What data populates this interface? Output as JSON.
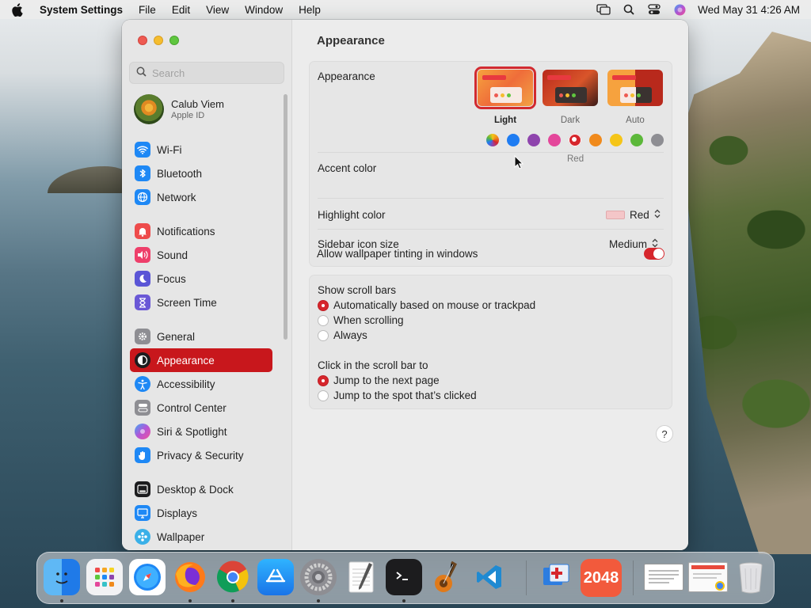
{
  "menubar": {
    "app_name": "System Settings",
    "menus": [
      "File",
      "Edit",
      "View",
      "Window",
      "Help"
    ],
    "clock": "Wed May 31  4:26 AM"
  },
  "sidebar": {
    "search_placeholder": "Search",
    "user": {
      "name": "Calub Viem",
      "subtitle": "Apple ID"
    },
    "items": [
      {
        "label": "Wi-Fi",
        "icon": "wifi-icon",
        "color": "#1e88f5"
      },
      {
        "label": "Bluetooth",
        "icon": "bluetooth-icon",
        "color": "#1e88f5"
      },
      {
        "label": "Network",
        "icon": "globe-icon",
        "color": "#1e88f5"
      },
      {
        "label": "Notifications",
        "icon": "bell-icon",
        "color": "#ee4b4b"
      },
      {
        "label": "Sound",
        "icon": "speaker-icon",
        "color": "#ee3f6a"
      },
      {
        "label": "Focus",
        "icon": "moon-icon",
        "color": "#5a55d6"
      },
      {
        "label": "Screen Time",
        "icon": "hourglass-icon",
        "color": "#6a58d6"
      },
      {
        "label": "General",
        "icon": "gear-icon",
        "color": "#8e8e93"
      },
      {
        "label": "Appearance",
        "icon": "appearance-icon",
        "color": "#1c1c1e"
      },
      {
        "label": "Accessibility",
        "icon": "accessibility-icon",
        "color": "#1e88f5"
      },
      {
        "label": "Control Center",
        "icon": "control-center-icon",
        "color": "#8e8e93"
      },
      {
        "label": "Siri & Spotlight",
        "icon": "siri-icon",
        "color": "#b455d6"
      },
      {
        "label": "Privacy & Security",
        "icon": "hand-icon",
        "color": "#1e88f5"
      },
      {
        "label": "Desktop & Dock",
        "icon": "dock-icon",
        "color": "#1c1c1e"
      },
      {
        "label": "Displays",
        "icon": "display-icon",
        "color": "#1e88f5"
      },
      {
        "label": "Wallpaper",
        "icon": "wallpaper-icon",
        "color": "#3ab0e8"
      }
    ],
    "selected": "Appearance"
  },
  "content": {
    "title": "Appearance",
    "appearance": {
      "label": "Appearance",
      "options": [
        "Light",
        "Dark",
        "Auto"
      ],
      "selected": "Light"
    },
    "accent": {
      "label": "Accent color",
      "colors": [
        "#multicolor",
        "#1e7cf2",
        "#8e44ad",
        "#e4479b",
        "#d6262c",
        "#f08a1c",
        "#f5c518",
        "#5cb83a",
        "#8e8e93"
      ],
      "selected_name": "Red"
    },
    "highlight": {
      "label": "Highlight color",
      "value": "Red"
    },
    "sidebar_icon_size": {
      "label": "Sidebar icon size",
      "value": "Medium"
    },
    "wallpaper_tinting": {
      "label": "Allow wallpaper tinting in windows",
      "on": true
    },
    "scroll_bars": {
      "title": "Show scroll bars",
      "options": [
        "Automatically based on mouse or trackpad",
        "When scrolling",
        "Always"
      ],
      "selected": 0
    },
    "click_scroll": {
      "title": "Click in the scroll bar to",
      "options": [
        "Jump to the next page",
        "Jump to the spot that’s clicked"
      ],
      "selected": 0
    },
    "help": "?"
  },
  "dock": {
    "apps": [
      "Finder",
      "Launchpad",
      "Safari",
      "Firefox",
      "Chrome",
      "App Store",
      "System Settings",
      "TextEdit",
      "Terminal",
      "GarageBand",
      "VS Code",
      "Remote Desktop",
      "2048",
      "Window 1",
      "Window 2",
      "Trash"
    ],
    "game_label": "2048"
  }
}
